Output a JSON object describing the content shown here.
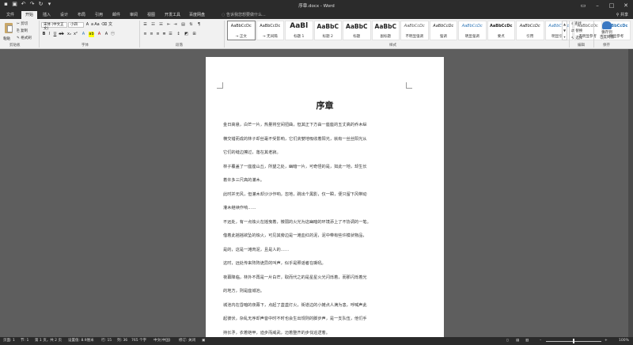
{
  "titlebar": {
    "title": "序章.docx - Word"
  },
  "tabs": [
    {
      "label": "文件",
      "active": false
    },
    {
      "label": "开始",
      "active": true
    },
    {
      "label": "插入",
      "active": false
    },
    {
      "label": "设计",
      "active": false
    },
    {
      "label": "布局",
      "active": false
    },
    {
      "label": "引用",
      "active": false
    },
    {
      "label": "邮件",
      "active": false
    },
    {
      "label": "审阅",
      "active": false
    },
    {
      "label": "视图",
      "active": false
    },
    {
      "label": "开发工具",
      "active": false
    },
    {
      "label": "百度网盘",
      "active": false
    }
  ],
  "search": {
    "placeholder": "告诉我您想要做什么..."
  },
  "share_label": "共享",
  "clipboard": {
    "paste": "粘贴",
    "cut": "剪切",
    "copy": "复制",
    "format_painter": "格式刷",
    "group": "剪贴板"
  },
  "font": {
    "name": "宋体 (中文正文)",
    "size": "小四",
    "group": "字体"
  },
  "paragraph": {
    "group": "段落"
  },
  "styles": {
    "group": "样式",
    "items": [
      {
        "sample": "AaBbCcDc",
        "name": "→ 正文",
        "selected": true
      },
      {
        "sample": "AaBbCcDc",
        "name": "→ 无间隔",
        "selected": false
      },
      {
        "sample": "AaBl",
        "name": "标题 1",
        "selected": false
      },
      {
        "sample": "AaBbC",
        "name": "标题 2",
        "selected": false
      },
      {
        "sample": "AaBbC",
        "name": "标题",
        "selected": false
      },
      {
        "sample": "AaBbC",
        "name": "副标题",
        "selected": false
      },
      {
        "sample": "AaBbCcDc",
        "name": "不明显强调",
        "selected": false
      },
      {
        "sample": "AaBbCcDc",
        "name": "强调",
        "selected": false
      },
      {
        "sample": "AaBbCcDc",
        "name": "明显强调",
        "selected": false
      },
      {
        "sample": "AaBbCcDc",
        "name": "要点",
        "selected": false
      },
      {
        "sample": "AaBbCcDc",
        "name": "引用",
        "selected": false
      },
      {
        "sample": "AaBbCcDc",
        "name": "明显引用",
        "selected": false
      },
      {
        "sample": "AaBbCcDc",
        "name": "不明显参考",
        "selected": false
      },
      {
        "sample": "AaBbCcDc",
        "name": "明显参考",
        "selected": false
      }
    ]
  },
  "editing": {
    "find": "查找",
    "replace": "替换",
    "select": "选择",
    "group": "编辑"
  },
  "save_net": {
    "label": "保存到\n百度网盘",
    "group": "保存"
  },
  "document": {
    "title": "序章",
    "lines": [
      "金日高悬，白芒一片，热量将空间扭曲，但其正下方由一座座的五丈高的乔木纵",
      "横交错而成的林子却丝毫不受影响，它们贪婪地吸收着阳光，就有一丝丝阳光从",
      "它们的缝边擦过，落在其老寂。",
      "林子覆盖了一座座山丘，所望之处，幽暗一片，可奇怪的是，如此一地，却生长",
      "着许多三尺高的灌木。",
      "此时并无风，但灌木却沙沙作响，忽地，跳出个黑影，仅一瞬，便只留下风带动",
      "灌木继续作响……",
      "不远处，有一点烛火在摇曳着，微弱的火光为这幽暗的环境添上了不协调的一笔。",
      "借着此摇摇欲坠的烛火，可见其旁边是一滩血红的泥，泥中带有些许模状物品，",
      "是的，这是一滩肉泥，且是人的……",
      "这时，远处传来阵阵诡异的叫声，似乎是照谣者在嘶吼。",
      "夜幕降临，林外不再是一片白芒，取而代之的是星星火光闪烁着，而那闪烁着光",
      "的地方，则是座城池。",
      "城池内在昏暗的夜幕下，点起了盏盏灯火，街道边的小摊点人满为患，呼喊声此",
      "起彼伏，杂乱无序却声音中时不时也会生出规则的脚步声，是一支队伍，他们手",
      "持长矛，衣着铠甲，迪步而威武，迈着整齐的步伐巡逻着。"
    ]
  },
  "status": {
    "page": "页面: 1",
    "section": "节: 1",
    "page_of": "第 1 页，共 2 页",
    "position": "设置值: 8.9厘米",
    "row": "行: 15",
    "col": "列: 36",
    "words": "765 个字",
    "language": "中文(中国)",
    "insert_mode": "修订: 关闭",
    "zoom": "100%"
  }
}
